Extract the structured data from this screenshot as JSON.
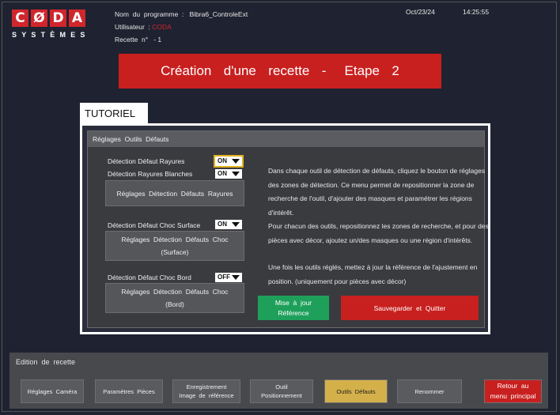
{
  "logo": {
    "letters": [
      "C",
      "Ø",
      "D",
      "A"
    ],
    "subtitle": "SYSTÈMES"
  },
  "header": {
    "program": "Nom  du  programme  :   Bibra6_ControleExt",
    "user_label": "Utilisateur  : ",
    "user_value": "CODA",
    "recipe": "Recette  n°   - 1",
    "date": "Oct/23/24",
    "time": "14:25:55"
  },
  "banner": {
    "title": "Création  d'une  recette  -   Etape  2"
  },
  "tutorial": {
    "tab_label": "TUTORIEL"
  },
  "panel": {
    "title": "Réglages  Outils  Défauts",
    "rows": {
      "rayures": {
        "label": "Détection  Défaut  Rayures",
        "value": "ON"
      },
      "rayures_blanches": {
        "label": "Détection  Rayures  Blanches",
        "value": "ON"
      },
      "btn_rayures": "Réglages  Détection  Défauts  Rayures",
      "choc_surface": {
        "label": "Détection  Défaut  Choc  Surface",
        "value": "ON"
      },
      "btn_choc_surface": "Réglages  Détection  Défauts  Choc\n(Surface)",
      "choc_bord": {
        "label": "Détection  Défaut  Choc  Bord",
        "value": "OFF"
      },
      "btn_choc_bord": "Réglages  Détection  Défauts  Choc\n(Bord)"
    },
    "help": {
      "p1": "Dans  chaque  outil  de  détection  de  défauts,  cliquez  le  bouton de  réglages  des  zones  de  détection.  Ce  menu  permet  de repositionner  la  zone  de  recherche  de  l'outil,  d'ajouter  des masques  et  paramétrer  les  régions  d'intérêt.",
      "p2": "Pour  chacun  des  outils,  repositionnez  les  zones  de  recherche, et  pour  des  pièces  avec  décor,  ajoutez  un/des  masques  ou une  région  d'intérêts.",
      "p3": "Une  fois  les  outils  réglés,  mettez  à  jour  la  référence  de l'ajustement  en  position.  (uniquement  pour  pièces  avec  décor)"
    },
    "update_btn": "Mise  à  jour\nRéférence",
    "save_btn": "Sauvegarder  et  Quitter"
  },
  "footer": {
    "title": "Edition  de  recette",
    "buttons": {
      "cameras": "Réglages  Caméra",
      "pieces": "Paramètres  Pièces",
      "reference": "Enregistrement\nImage  de  référence",
      "positionnement": "Outil\nPositionnement",
      "defauts": "Outils  Défauts",
      "renommer": "Renommer",
      "retour": "Retour  au\nmenu  principal"
    }
  },
  "colors": {
    "accent_red": "#c8201f",
    "accent_green": "#1ea05a",
    "active_tab": "#d4b04a",
    "background": "#1f2230"
  }
}
